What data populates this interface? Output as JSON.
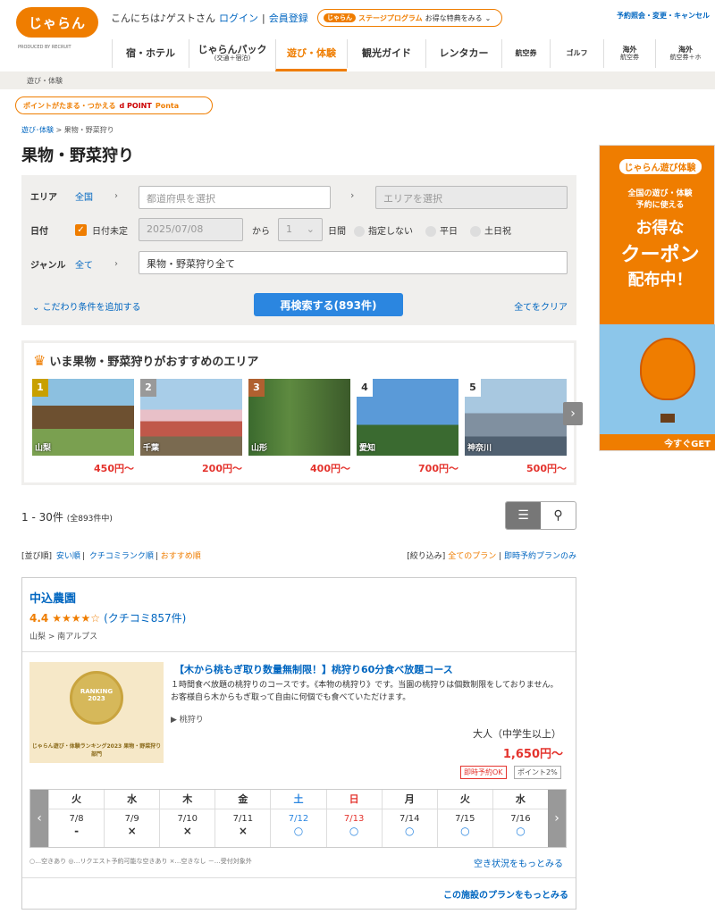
{
  "header": {
    "logo": "じゃらん",
    "produced": "PRODUCED BY RECRUIT",
    "greeting": "こんにちは♪ゲストさん",
    "login": "ログイン",
    "register": "会員登録",
    "stage_logo": "じゃらん",
    "stage_label": "ステージプログラム",
    "stage_offer": "お得な特典をみる",
    "top_links": "予約照会・変更・キャンセル"
  },
  "nav": [
    {
      "label": "宿・ホテル",
      "sub": ""
    },
    {
      "label": "じゃらんパック",
      "sub": "(交通＋宿泊)"
    },
    {
      "label": "遊び・体験",
      "sub": ""
    },
    {
      "label": "観光ガイド",
      "sub": ""
    },
    {
      "label": "レンタカー",
      "sub": ""
    },
    {
      "label": "航空券",
      "sub": ""
    },
    {
      "label": "ゴルフ",
      "sub": ""
    },
    {
      "label": "海外",
      "sub": "航空券"
    },
    {
      "label": "海外",
      "sub": "航空券＋ホ"
    }
  ],
  "subnav": "遊び・体験",
  "points": {
    "text": "ポイントがたまる・つかえる",
    "d": "d POINT",
    "ponta": "Ponta"
  },
  "breadcrumb": {
    "parent": "遊び･体験",
    "sep": ">",
    "current": "果物・野菜狩り"
  },
  "title": "果物・野菜狩り",
  "search": {
    "area_label": "エリア",
    "area_value": "全国",
    "pref_ph": "都道府県を選択",
    "area_ph": "エリアを選択",
    "date_label": "日付",
    "date_undecided": "日付未定",
    "date": "2025/07/08",
    "from": "から",
    "days": "1",
    "days_label": "日間",
    "opt1": "指定しない",
    "opt2": "平日",
    "opt3": "土日祝",
    "genre_label": "ジャンル",
    "genre_value": "全て",
    "genre_select": "果物・野菜狩り全て",
    "more": "こだわり条件を追加する",
    "submit": "再検索する(893件)",
    "clear": "全てをクリア"
  },
  "ad": {
    "title": "じゃらん遊び体験",
    "l1": "全国の遊び・体験",
    "l2": "予約に使える",
    "l3": "お得な",
    "l4": "クーポン",
    "l5": "配布中！",
    "cta": "今すぐGET"
  },
  "rec": {
    "title": "いま果物・野菜狩りがおすすめのエリア",
    "areas": [
      {
        "rank": "1",
        "name": "山梨",
        "price": "450円〜"
      },
      {
        "rank": "2",
        "name": "千葉",
        "price": "200円〜"
      },
      {
        "rank": "3",
        "name": "山形",
        "price": "400円〜"
      },
      {
        "rank": "4",
        "name": "愛知",
        "price": "700円〜"
      },
      {
        "rank": "5",
        "name": "神奈川",
        "price": "500円〜"
      }
    ]
  },
  "results": {
    "range": "1 - 30件",
    "total": "(全893件中)",
    "sort_label": "[並び順]",
    "sort1": "安い順",
    "sort2": "クチコミランク順",
    "sort3": "おすすめ順",
    "filter_label": "[絞り込み]",
    "filter1": "全てのプラン",
    "filter2": "即時予約プランのみ"
  },
  "item": {
    "name": "中込農園",
    "score": "4.4",
    "stars": "★★★★☆",
    "reviews": "(クチコミ857件)",
    "area": "山梨 > 南アルプス",
    "thumb_text": "じゃらん遊び・体験ランキング2023 果物・野菜狩り部門",
    "thumb_medal": "RANKING 2023",
    "plan_title": "【木から桃もぎ取り数量無制限！】桃狩り60分食べ放題コース",
    "plan_desc": "１時間食べ放題の桃狩りのコースです。《本物の桃狩り》です。当園の桃狩りは個数制限をしておりません。お客様自ら木からもぎ取って自由に何個でも食べていただけます。",
    "tag": "桃狩り",
    "adult": "大人（中学生以上）",
    "price": "1,650円〜",
    "badge1": "即時予約OK",
    "badge2": "ポイント2%",
    "cal": [
      {
        "w": "火",
        "d": "7/8",
        "s": "-"
      },
      {
        "w": "水",
        "d": "7/9",
        "s": "×"
      },
      {
        "w": "木",
        "d": "7/10",
        "s": "×"
      },
      {
        "w": "金",
        "d": "7/11",
        "s": "×"
      },
      {
        "w": "土",
        "d": "7/12",
        "s": "○"
      },
      {
        "w": "日",
        "d": "7/13",
        "s": "○"
      },
      {
        "w": "月",
        "d": "7/14",
        "s": "○"
      },
      {
        "w": "火",
        "d": "7/15",
        "s": "○"
      },
      {
        "w": "水",
        "d": "7/16",
        "s": "○"
      }
    ],
    "legend": "○…空きあり ◎…リクエスト予約可能な空きあり ×…空きなし －…受付対象外",
    "more_avail": "空き状況をもっとみる",
    "more_plans": "この施設のプランをもっとみる"
  }
}
